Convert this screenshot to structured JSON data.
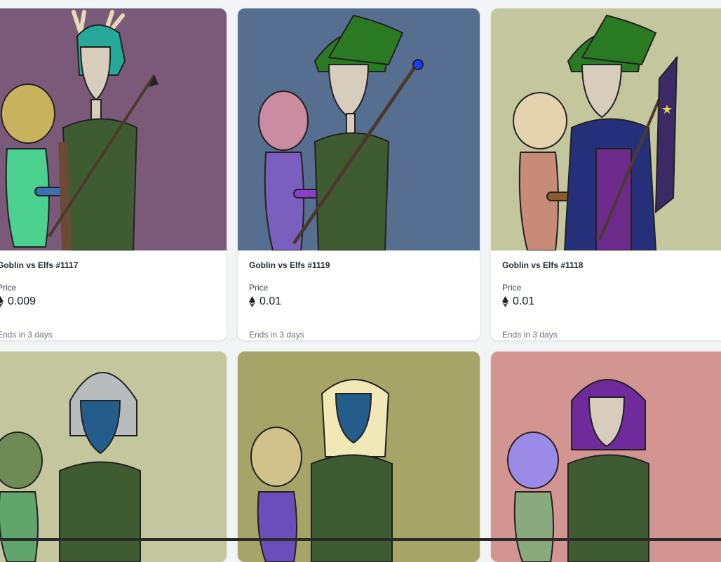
{
  "cards": [
    {
      "title": "Goblin vs Elfs #1117",
      "price_label": "Price",
      "price": "0.009",
      "ends": "Ends in 3 days",
      "bg": "#7b5a79"
    },
    {
      "title": "Goblin vs Elfs #1119",
      "price_label": "Price",
      "price": "0.01",
      "ends": "Ends in 3 days",
      "bg": "#566e8f"
    },
    {
      "title": "Goblin vs Elfs #1118",
      "price_label": "Price",
      "price": "0.01",
      "ends": "Ends in 3 days",
      "bg": "#c4c69d"
    },
    {
      "title": "",
      "price_label": "",
      "price": "",
      "ends": "",
      "bg": "#c4c69d"
    },
    {
      "title": "",
      "price_label": "",
      "price": "",
      "ends": "",
      "bg": "#a6a466"
    },
    {
      "title": "",
      "price_label": "",
      "price": "",
      "ends": "",
      "bg": "#d29592"
    }
  ],
  "icons": {
    "currency": "ethereum-icon"
  }
}
